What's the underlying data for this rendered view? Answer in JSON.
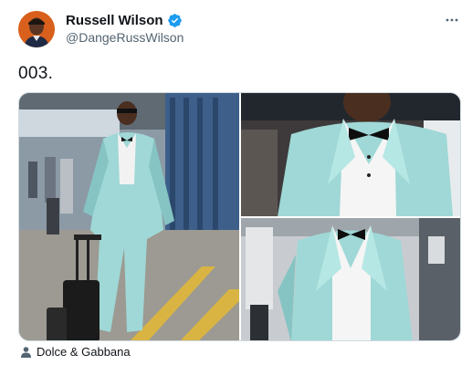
{
  "tweet": {
    "display_name": "Russell Wilson",
    "handle": "@DangeRussWilson",
    "text": "003.",
    "verified": true,
    "tagged_user": "Dolce & Gabbana"
  },
  "icons": {
    "verified": "verified-badge-icon",
    "more": "more-options-icon",
    "tag": "person-icon"
  },
  "colors": {
    "verified_blue": "#1d9bf0",
    "secondary_text": "#536471",
    "suit": "#9fd8d6"
  }
}
